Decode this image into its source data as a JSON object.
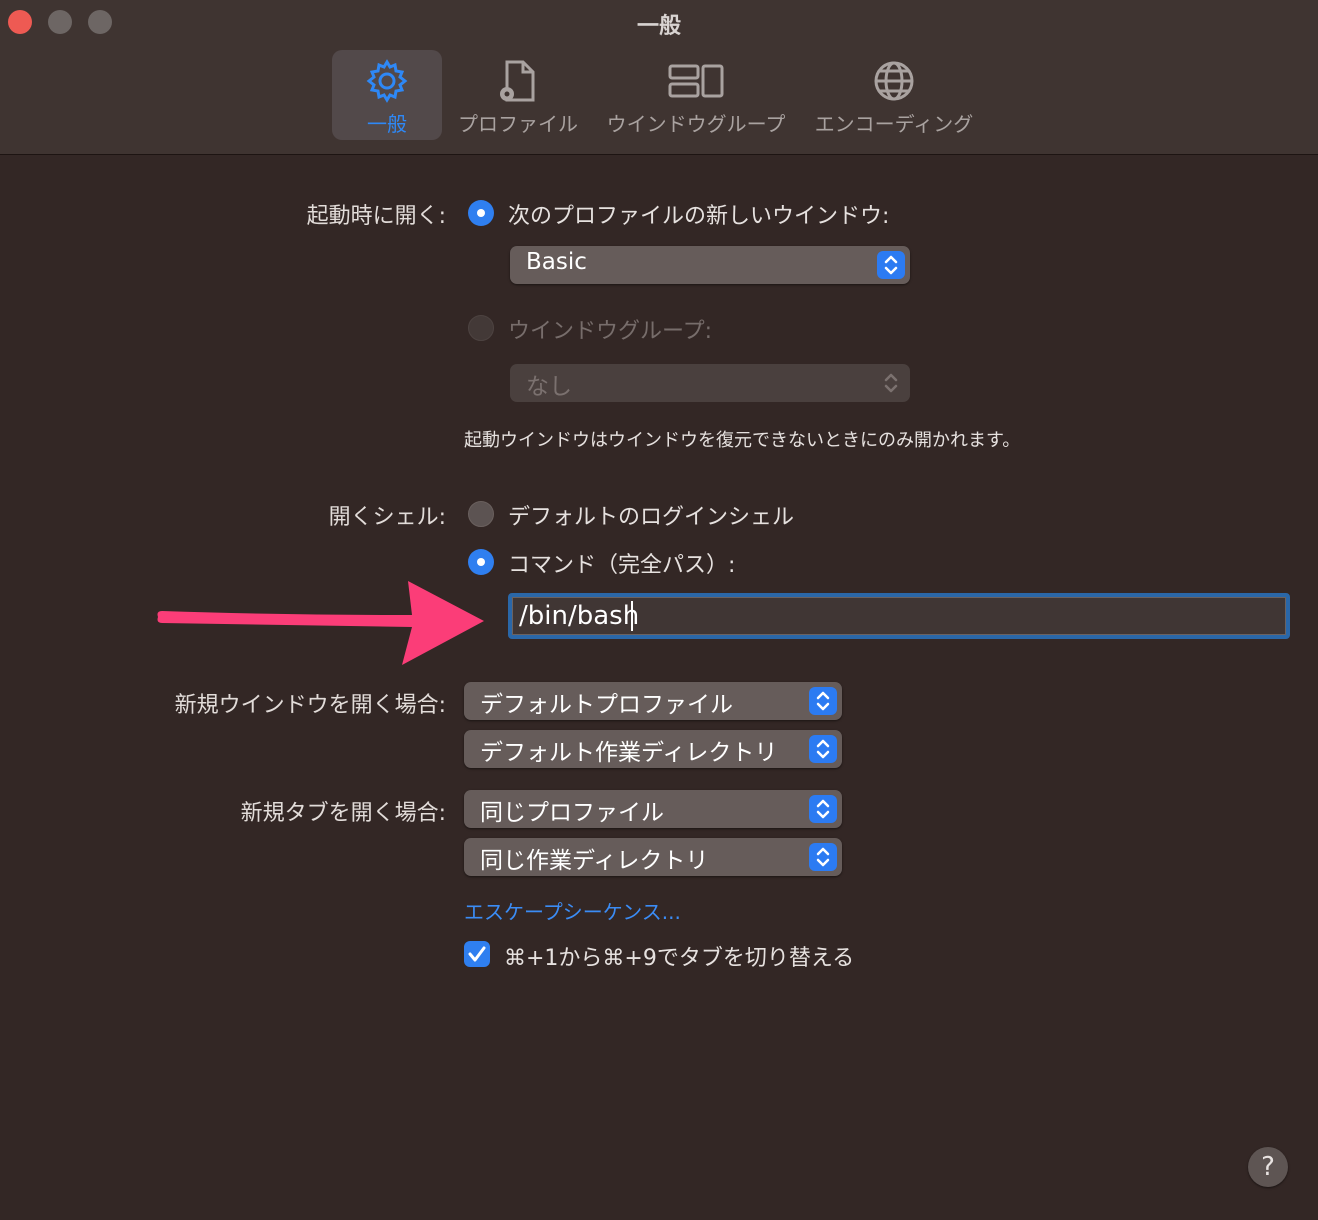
{
  "window": {
    "title": "一般"
  },
  "toolbar": {
    "tabs": [
      {
        "label": "一般",
        "icon": "gear-icon",
        "active": true
      },
      {
        "label": "プロファイル",
        "icon": "profile-document-icon",
        "active": false
      },
      {
        "label": "ウインドウグループ",
        "icon": "window-group-icon",
        "active": false
      },
      {
        "label": "エンコーディング",
        "icon": "globe-icon",
        "active": false
      }
    ]
  },
  "startup": {
    "label": "起動時に開く:",
    "option_profile_label": "次のプロファイルの新しいウインドウ:",
    "profile_value": "Basic",
    "option_group_label": "ウインドウグループ:",
    "group_value": "なし",
    "note": "起動ウインドウはウインドウを復元できないときにのみ開かれます。"
  },
  "shell": {
    "label": "開くシェル:",
    "option_default_label": "デフォルトのログインシェル",
    "option_command_label": "コマンド（完全パス）:",
    "command_value": "/bin/bash"
  },
  "new_window": {
    "label": "新規ウインドウを開く場合:",
    "profile_value": "デフォルトプロファイル",
    "directory_value": "デフォルト作業ディレクトリ"
  },
  "new_tab": {
    "label": "新規タブを開く場合:",
    "profile_value": "同じプロファイル",
    "directory_value": "同じ作業ディレクトリ"
  },
  "escape_sequences_link": "エスケープシーケンス...",
  "tab_switch_checkbox": {
    "label": "⌘+1から⌘+9でタブを切り替える",
    "checked": true
  },
  "help": {
    "label": "?"
  },
  "colors": {
    "accent": "#2f7ff0",
    "arrow": "#fb3d78",
    "background": "#332725"
  }
}
